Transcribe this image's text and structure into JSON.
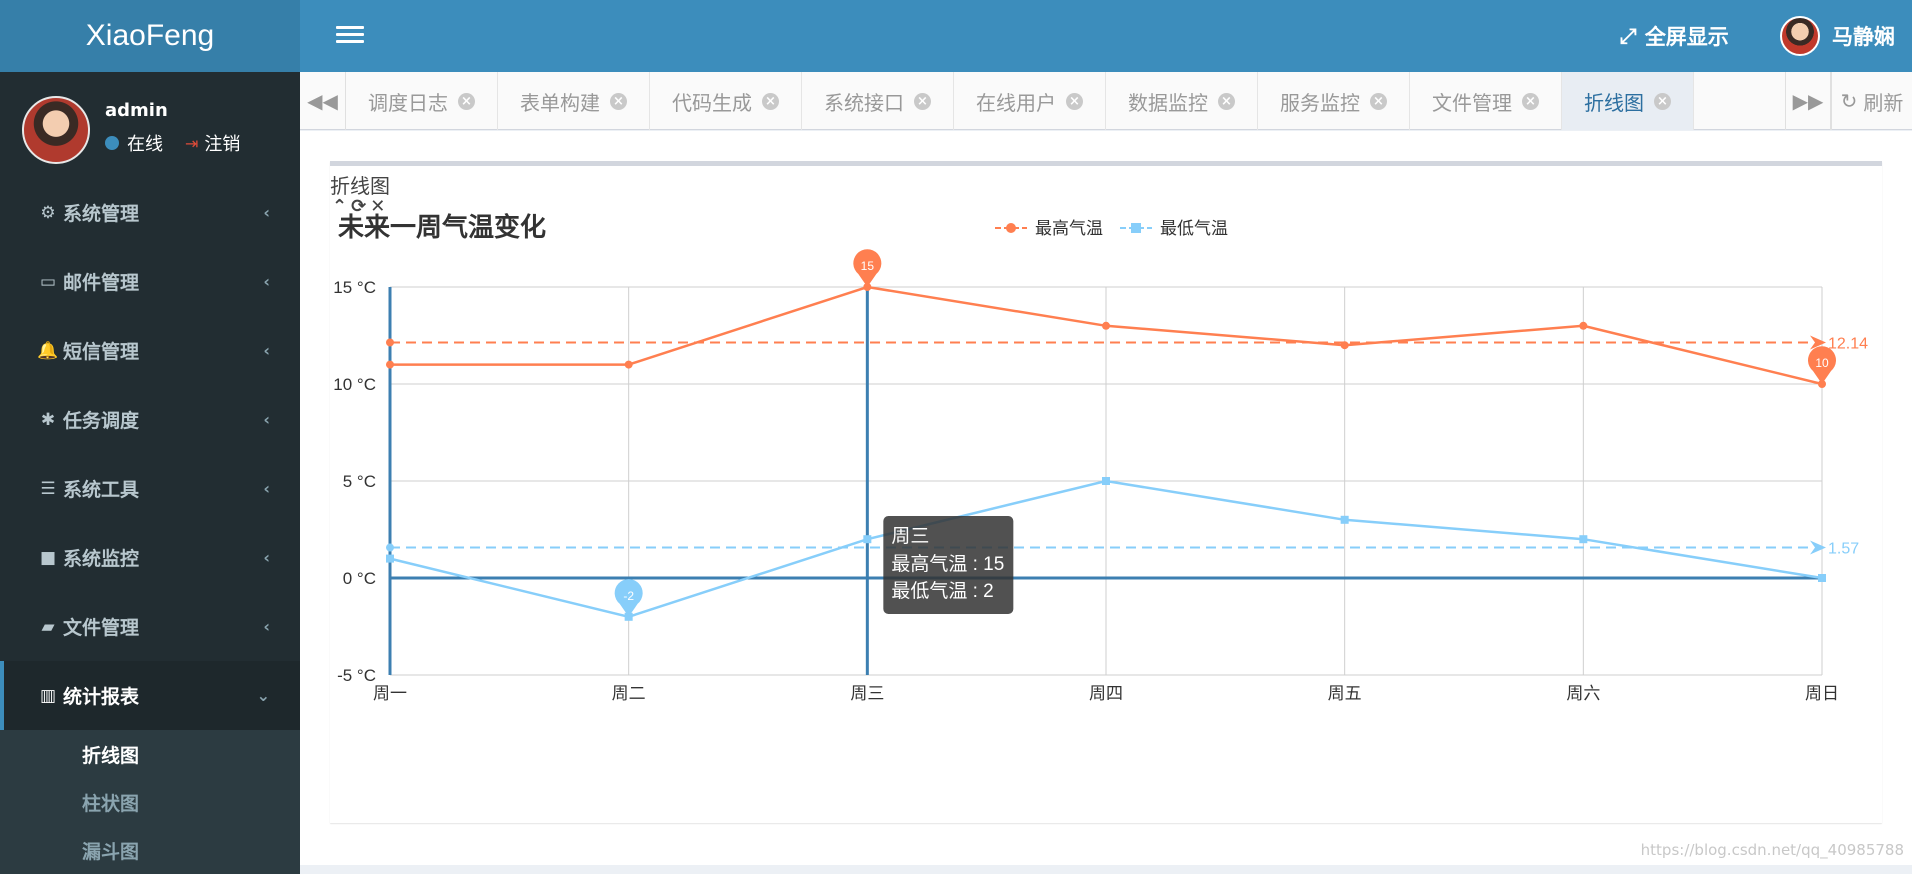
{
  "header": {
    "logo": "XiaoFeng",
    "fullscreen_label": "全屏显示",
    "username": "马静娴"
  },
  "sidebar": {
    "user": {
      "name": "admin",
      "status": "在线",
      "logout": "注销"
    },
    "items": [
      {
        "label": "系统管理",
        "icon": "gear-icon",
        "glyph": "⚙"
      },
      {
        "label": "邮件管理",
        "icon": "calendar-icon",
        "glyph": "▭"
      },
      {
        "label": "短信管理",
        "icon": "bell-icon",
        "glyph": "🔔"
      },
      {
        "label": "任务调度",
        "icon": "asterisk-icon",
        "glyph": "✱"
      },
      {
        "label": "系统工具",
        "icon": "bars-icon",
        "glyph": "☰"
      },
      {
        "label": "系统监控",
        "icon": "video-icon",
        "glyph": "■"
      },
      {
        "label": "文件管理",
        "icon": "book-icon",
        "glyph": "▰"
      },
      {
        "label": "统计报表",
        "icon": "bar-chart-icon",
        "glyph": "▥"
      }
    ],
    "subitems": [
      "折线图",
      "柱状图",
      "漏斗图"
    ]
  },
  "tabs": [
    "调度日志",
    "表单构建",
    "代码生成",
    "系统接口",
    "在线用户",
    "数据监控",
    "服务监控",
    "文件管理",
    "折线图"
  ],
  "refresh_label": "刷新",
  "box": {
    "title": "折线图"
  },
  "watermark": "https://blog.csdn.net/qq_40985788",
  "chart_data": {
    "type": "line",
    "title": "未来一周气温变化",
    "categories": [
      "周一",
      "周二",
      "周三",
      "周四",
      "周五",
      "周六",
      "周日"
    ],
    "series": [
      {
        "name": "最高气温",
        "values": [
          11,
          11,
          15,
          13,
          12,
          13,
          10
        ],
        "color": "#ff7f50",
        "average": 12.14,
        "max_label": "15",
        "min_label": "10"
      },
      {
        "name": "最低气温",
        "values": [
          1,
          -2,
          2,
          5,
          3,
          2,
          0
        ],
        "color": "#87cefa",
        "average": 1.57,
        "min_label": "-2"
      }
    ],
    "y_ticks": [
      "-5 °C",
      "0 °C",
      "5 °C",
      "10 °C",
      "15 °C"
    ],
    "ylim": [
      -5,
      15
    ],
    "grid": true,
    "legend": "top-center",
    "tooltip": {
      "category": "周三",
      "lines": [
        "最高气温 : 15",
        "最低气温 : 2"
      ]
    }
  }
}
